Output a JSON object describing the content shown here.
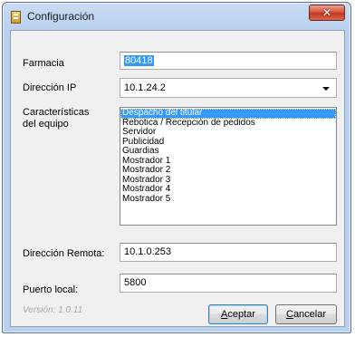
{
  "window": {
    "title": "Configuración",
    "close_glyph": "✕"
  },
  "fields": {
    "farmacia": {
      "label": "Farmacia",
      "value": "80418"
    },
    "ip": {
      "label": "Dirección IP",
      "value": "10.1.24.2"
    },
    "caracteristicas": {
      "label_line1": "Características",
      "label_line2": "del equipo",
      "items": [
        "Despacho del titular",
        "Rebotica / Recepción de pedidos",
        "Servidor",
        "Publicidad",
        "Guardias",
        "Mostrador 1",
        "Mostrador 2",
        "Mostrador 3",
        "Mostrador 4",
        "Mostrador 5"
      ],
      "selected_index": 0
    },
    "remota": {
      "label": "Dirección Remota:",
      "value": "10.1.0.253"
    },
    "puerto": {
      "label": "Puerto local:",
      "value": "5800"
    }
  },
  "footer": {
    "version": "Versión: 1.0.11",
    "accept": {
      "accel": "A",
      "rest": "ceptar"
    },
    "cancel": {
      "accel": "C",
      "rest": "ancelar"
    }
  },
  "icons": {
    "app": "app-icon",
    "close": "close-icon",
    "dropdown": "chevron-down-icon"
  },
  "colors": {
    "selection": "#3399ff",
    "close_button": "#c94a30",
    "frame": "#b9d1ee"
  }
}
